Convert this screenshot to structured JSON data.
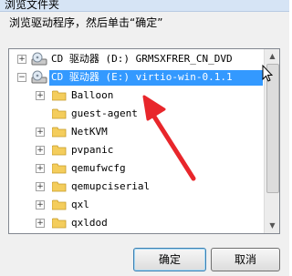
{
  "window": {
    "title": "浏览文件夹"
  },
  "instruction": "浏览驱动程序，然后单击“确定”",
  "tree": {
    "drives": [
      {
        "label": "CD 驱动器 (D:) GRMSXFRER_CN_DVD",
        "expander": "+",
        "selected": false
      },
      {
        "label": "CD 驱动器 (E:) virtio-win-0.1.1",
        "expander": "−",
        "selected": true
      }
    ],
    "folders": [
      {
        "label": "Balloon",
        "expander": "+"
      },
      {
        "label": "guest-agent",
        "expander": ""
      },
      {
        "label": "NetKVM",
        "expander": "+"
      },
      {
        "label": "pvpanic",
        "expander": "+"
      },
      {
        "label": "qemufwcfg",
        "expander": "+"
      },
      {
        "label": "qemupciserial",
        "expander": "+"
      },
      {
        "label": "qxl",
        "expander": "+"
      },
      {
        "label": "qxldod",
        "expander": "+"
      }
    ]
  },
  "buttons": {
    "ok": "确定",
    "cancel": "取消"
  },
  "colors": {
    "selection": "#3399ff",
    "annotation_arrow": "#e8262b",
    "folder": "#f4cd5c"
  },
  "icons": {
    "drive": "cd-drive-icon",
    "folder": "folder-icon",
    "annotation": "red-arrow-annotation",
    "cursor": "mouse-pointer-icon"
  }
}
